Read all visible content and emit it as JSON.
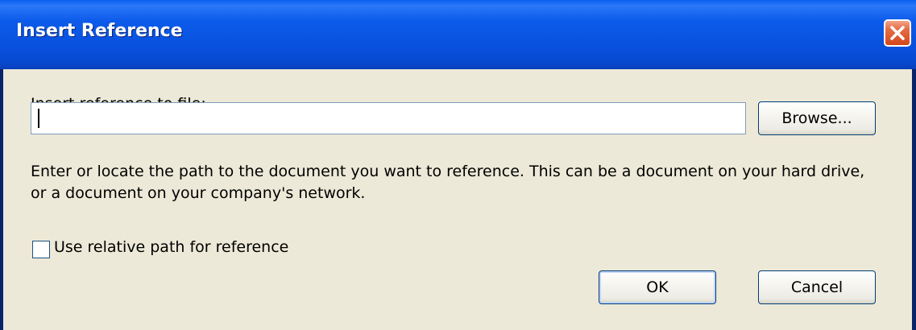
{
  "window": {
    "title": "Insert Reference"
  },
  "form": {
    "file_label": "Insert reference to file:",
    "path_value": "",
    "browse_label": "Browse...",
    "description": "Enter or locate the path to the document you want to reference. This can be a document on your hard drive, or a document on your company's network.",
    "relative_path_label": "Use relative path for reference",
    "relative_path_checked": false
  },
  "buttons": {
    "ok_label": "OK",
    "cancel_label": "Cancel"
  },
  "icons": {
    "close": "close-icon"
  },
  "colors": {
    "titlebar": "#0850dd",
    "dialog_bg": "#ece9d8",
    "close_button": "#d4471c"
  }
}
